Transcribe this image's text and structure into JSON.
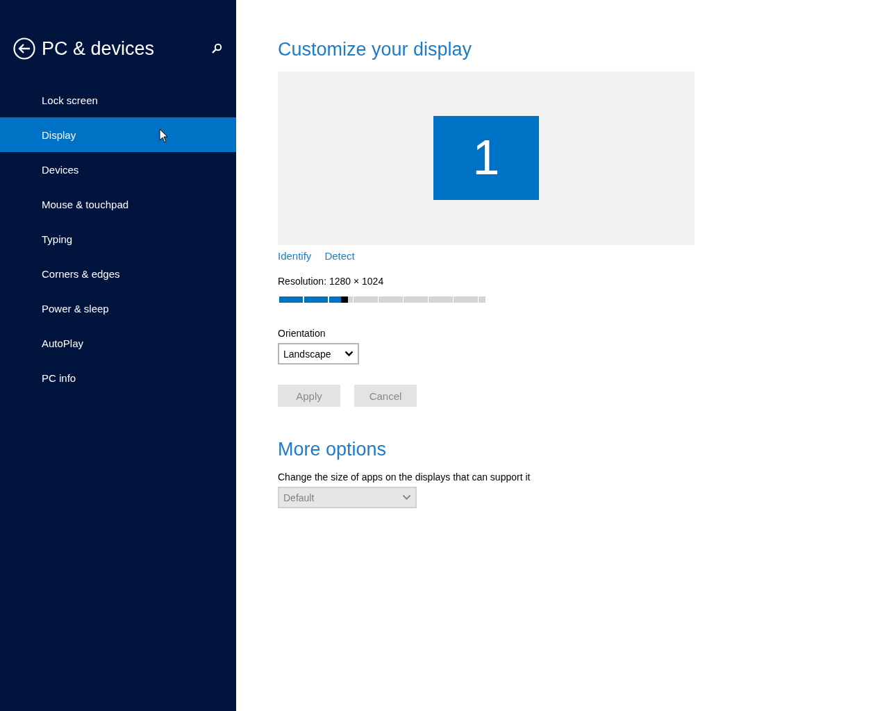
{
  "header": {
    "title": "PC & devices"
  },
  "sidebar": {
    "items": [
      {
        "label": "Lock screen",
        "selected": false
      },
      {
        "label": "Display",
        "selected": true
      },
      {
        "label": "Devices",
        "selected": false
      },
      {
        "label": "Mouse & touchpad",
        "selected": false
      },
      {
        "label": "Typing",
        "selected": false
      },
      {
        "label": "Corners & edges",
        "selected": false
      },
      {
        "label": "Power & sleep",
        "selected": false
      },
      {
        "label": "AutoPlay",
        "selected": false
      },
      {
        "label": "PC info",
        "selected": false
      }
    ]
  },
  "main": {
    "title": "Customize your display",
    "monitor": {
      "number": "1"
    },
    "links": [
      "Identify",
      "Detect"
    ],
    "resolution": {
      "label": "Resolution: 1280 × 1024",
      "level": 0.32
    },
    "orientation": {
      "label": "Orientation",
      "value": "Landscape"
    },
    "buttons": [
      {
        "label": "Apply",
        "disabled": true
      },
      {
        "label": "Cancel",
        "disabled": true
      }
    ],
    "more_options": {
      "title": "More options",
      "label": "Change the size of apps on the displays that can support it",
      "dropdown": {
        "value": "Default",
        "disabled": true
      }
    }
  }
}
